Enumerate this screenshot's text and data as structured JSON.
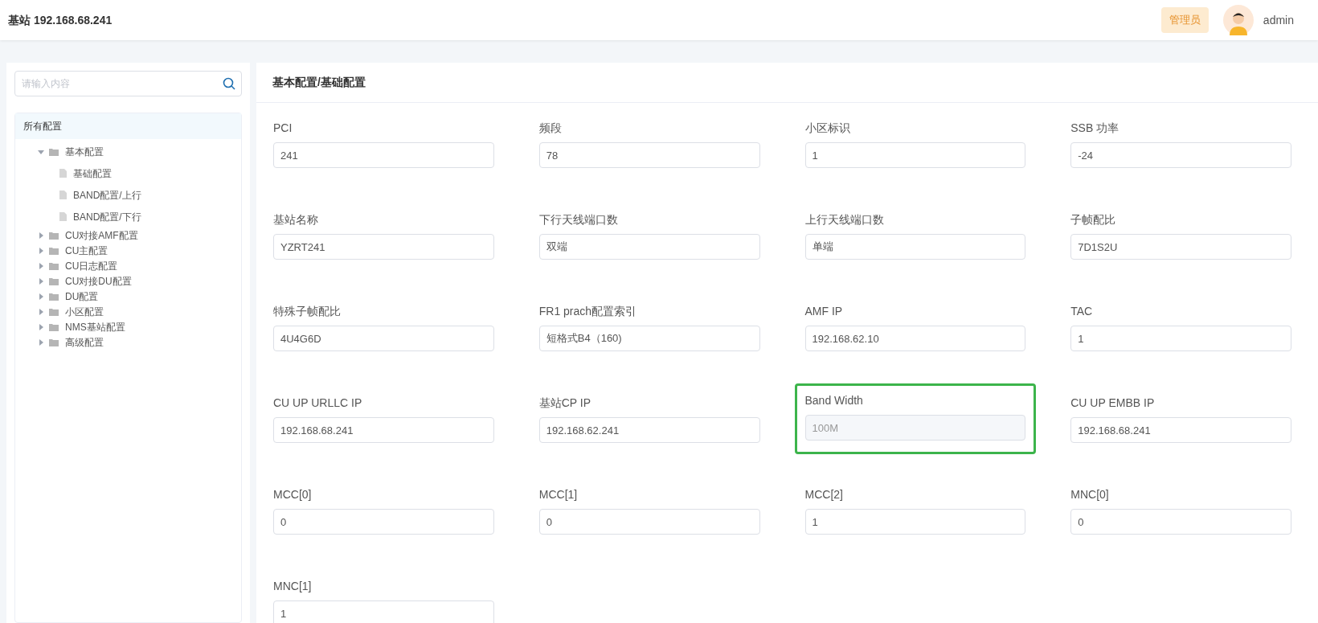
{
  "header": {
    "title": "基站 192.168.68.241",
    "role_badge": "管理员",
    "username": "admin"
  },
  "sidebar": {
    "search": {
      "placeholder": "请输入内容"
    },
    "tree_title": "所有配置",
    "tree": [
      {
        "label": "基本配置",
        "kind": "folder",
        "expanded": true,
        "children": [
          {
            "label": "基础配置",
            "kind": "file"
          },
          {
            "label": "BAND配置/上行",
            "kind": "file"
          },
          {
            "label": "BAND配置/下行",
            "kind": "file"
          }
        ]
      },
      {
        "label": "CU对接AMF配置",
        "kind": "folder",
        "expanded": false
      },
      {
        "label": "CU主配置",
        "kind": "folder",
        "expanded": false
      },
      {
        "label": "CU日志配置",
        "kind": "folder",
        "expanded": false
      },
      {
        "label": "CU对接DU配置",
        "kind": "folder",
        "expanded": false
      },
      {
        "label": "DU配置",
        "kind": "folder",
        "expanded": false
      },
      {
        "label": "小区配置",
        "kind": "folder",
        "expanded": false
      },
      {
        "label": "NMS基站配置",
        "kind": "folder",
        "expanded": false
      },
      {
        "label": "高级配置",
        "kind": "folder",
        "expanded": false
      }
    ]
  },
  "content": {
    "breadcrumb": "基本配置/基础配置",
    "fields": [
      {
        "label": "PCI",
        "value": "241",
        "disabled": false,
        "highlighted": false
      },
      {
        "label": "频段",
        "value": "78",
        "disabled": false,
        "highlighted": false
      },
      {
        "label": "小区标识",
        "value": "1",
        "disabled": false,
        "highlighted": false
      },
      {
        "label": "SSB 功率",
        "value": "-24",
        "disabled": false,
        "highlighted": false
      },
      {
        "label": "基站名称",
        "value": "YZRT241",
        "disabled": false,
        "highlighted": false
      },
      {
        "label": "下行天线端口数",
        "value": "双端",
        "disabled": false,
        "highlighted": false
      },
      {
        "label": "上行天线端口数",
        "value": "单端",
        "disabled": false,
        "highlighted": false
      },
      {
        "label": "子帧配比",
        "value": "7D1S2U",
        "disabled": false,
        "highlighted": false
      },
      {
        "label": "特殊子帧配比",
        "value": "4U4G6D",
        "disabled": false,
        "highlighted": false
      },
      {
        "label": "FR1 prach配置索引",
        "value": "短格式B4（160)",
        "disabled": false,
        "highlighted": false
      },
      {
        "label": "AMF IP",
        "value": "192.168.62.10",
        "disabled": false,
        "highlighted": false
      },
      {
        "label": "TAC",
        "value": "1",
        "disabled": false,
        "highlighted": false
      },
      {
        "label": "CU UP URLLC IP",
        "value": "192.168.68.241",
        "disabled": false,
        "highlighted": false
      },
      {
        "label": "基站CP IP",
        "value": "192.168.62.241",
        "disabled": false,
        "highlighted": false
      },
      {
        "label": "Band Width",
        "value": "100M",
        "disabled": true,
        "highlighted": true
      },
      {
        "label": "CU UP EMBB IP",
        "value": "192.168.68.241",
        "disabled": false,
        "highlighted": false
      },
      {
        "label": "MCC[0]",
        "value": "0",
        "disabled": false,
        "highlighted": false
      },
      {
        "label": "MCC[1]",
        "value": "0",
        "disabled": false,
        "highlighted": false
      },
      {
        "label": "MCC[2]",
        "value": "1",
        "disabled": false,
        "highlighted": false
      },
      {
        "label": "MNC[0]",
        "value": "0",
        "disabled": false,
        "highlighted": false
      },
      {
        "label": "MNC[1]",
        "value": "1",
        "disabled": false,
        "highlighted": false
      }
    ]
  }
}
